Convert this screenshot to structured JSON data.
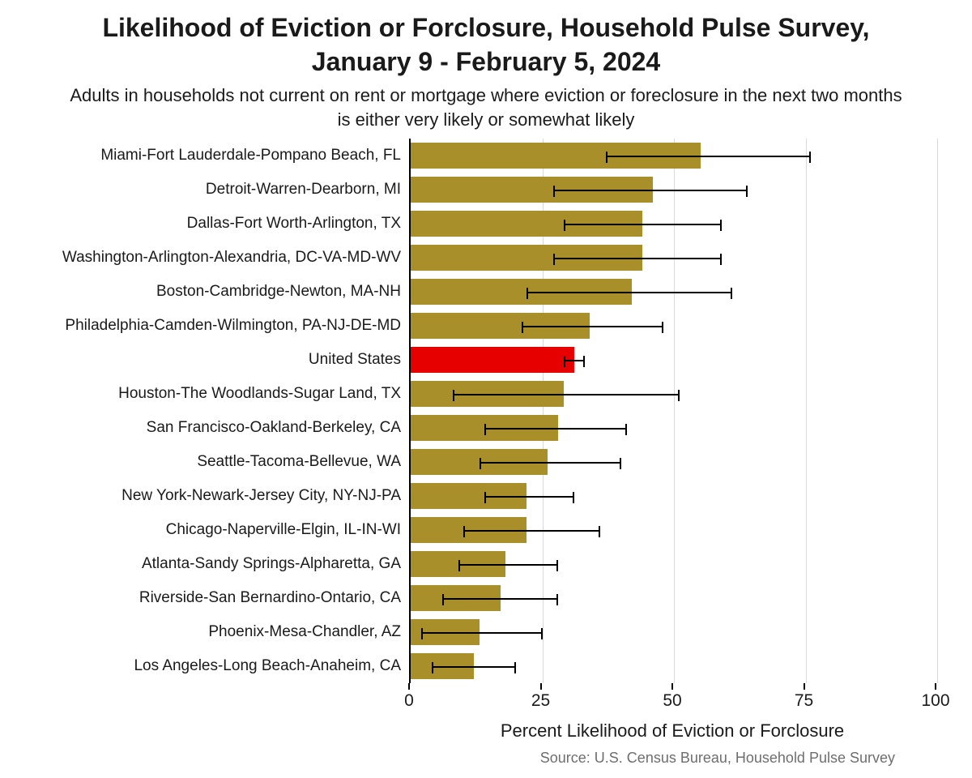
{
  "chart_data": {
    "type": "bar",
    "orientation": "horizontal",
    "title": "Likelihood of Eviction or Forclosure, Household Pulse Survey, January 9 - February 5, 2024",
    "subtitle": "Adults in households not current on rent or mortgage where eviction or foreclosure in the next two months is either very likely or somewhat likely",
    "xlabel": "Percent Likelihood of Eviction or Forclosure",
    "ylabel": "",
    "xlim": [
      0,
      100
    ],
    "xticks": [
      0,
      25,
      50,
      75,
      100
    ],
    "highlight_category": "United States",
    "colors": {
      "bar": "#a88f2a",
      "highlight": "#e60000"
    },
    "source": "Source: U.S. Census Bureau, Household Pulse Survey",
    "categories": [
      "Miami-Fort Lauderdale-Pompano Beach, FL",
      "Detroit-Warren-Dearborn, MI",
      "Dallas-Fort Worth-Arlington, TX",
      "Washington-Arlington-Alexandria, DC-VA-MD-WV",
      "Boston-Cambridge-Newton, MA-NH",
      "Philadelphia-Camden-Wilmington, PA-NJ-DE-MD",
      "United States",
      "Houston-The Woodlands-Sugar Land, TX",
      "San Francisco-Oakland-Berkeley, CA",
      "Seattle-Tacoma-Bellevue, WA",
      "New York-Newark-Jersey City, NY-NJ-PA",
      "Chicago-Naperville-Elgin, IL-IN-WI",
      "Atlanta-Sandy Springs-Alpharetta, GA",
      "Riverside-San Bernardino-Ontario, CA",
      "Phoenix-Mesa-Chandler, AZ",
      "Los Angeles-Long Beach-Anaheim, CA"
    ],
    "values": [
      55,
      46,
      44,
      44,
      42,
      34,
      31,
      29,
      28,
      26,
      22,
      22,
      18,
      17,
      13,
      12
    ],
    "err_low": [
      37,
      27,
      29,
      27,
      22,
      21,
      29,
      8,
      14,
      13,
      14,
      10,
      9,
      6,
      2,
      4
    ],
    "err_high": [
      76,
      64,
      59,
      59,
      61,
      48,
      33,
      51,
      41,
      40,
      31,
      36,
      28,
      28,
      25,
      20
    ]
  }
}
